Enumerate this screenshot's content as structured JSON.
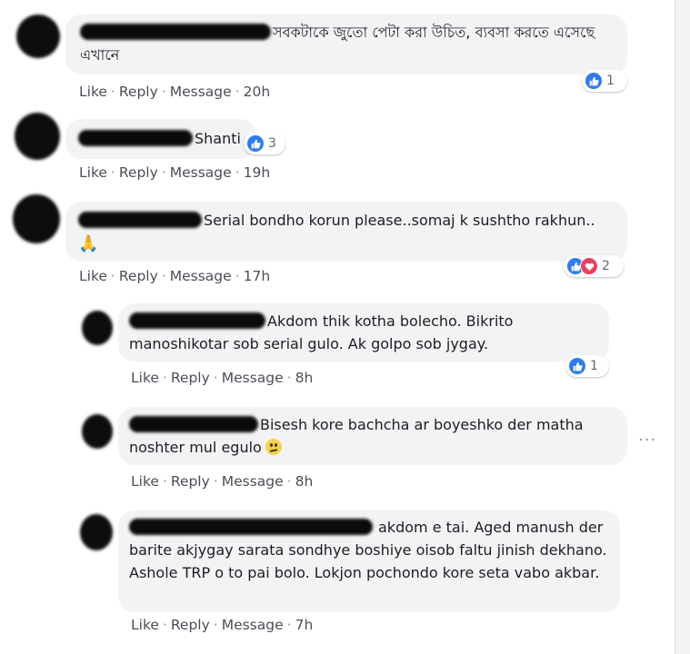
{
  "actions": {
    "like": "Like",
    "reply": "Reply",
    "message": "Message",
    "separator": "·"
  },
  "colors": {
    "bubble": "#f2f3f5",
    "like_blue": "#2e7bf0",
    "love_red": "#ef3e5c",
    "action_text": "#4b4f56"
  },
  "comments": [
    {
      "text": "সবকটাকে জুতো পেটা করা উচিত, ব্যবসা করতে এসেছে এখানে",
      "time": "20h",
      "reactions": {
        "icons": [
          "like-icon"
        ],
        "count": "1"
      }
    },
    {
      "text": "Shanti",
      "time": "19h",
      "reactions": {
        "icons": [
          "like-icon"
        ],
        "count": "3"
      }
    },
    {
      "text": "Serial bondho korun please..somaj k sushtho rakhun..",
      "emoji": "🙏",
      "time": "17h",
      "reactions": {
        "icons": [
          "like-icon",
          "love-icon"
        ],
        "count": "2"
      }
    }
  ],
  "replies": [
    {
      "text": "Akdom thik kotha bolecho. Bikrito manoshikotar sob serial gulo. Ak golpo sob jygay.",
      "time": "8h",
      "reactions": {
        "icons": [
          "like-icon"
        ],
        "count": "1"
      }
    },
    {
      "text": "Bisesh kore bachcha ar boyeshko der matha noshter mul egulo",
      "emoji": "confused-face",
      "time": "8h",
      "more_icon": "···"
    },
    {
      "text": "akdom e tai. Aged manush der barite akjygay sarata sondhye boshiye oisob faltu jinish dekhano. Ashole TRP o to pai bolo. Lokjon pochondo kore seta vabo akbar.",
      "time": "7h"
    }
  ]
}
